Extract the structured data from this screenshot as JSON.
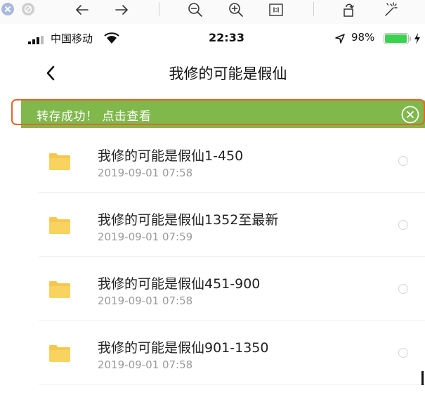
{
  "status_bar": {
    "carrier": "中国移动",
    "time": "22:33",
    "battery": "98%",
    "battery_level": 0.98
  },
  "nav": {
    "title": "我修的可能是假仙"
  },
  "banner": {
    "text": "转存成功！ 点击查看",
    "color": "#80b84c"
  },
  "files": [
    {
      "name": "我修的可能是假仙1-450",
      "date": "2019-09-01 07:58"
    },
    {
      "name": "我修的可能是假仙1352至最新",
      "date": "2019-09-01 07:59"
    },
    {
      "name": "我修的可能是假仙451-900",
      "date": "2019-09-01 07:58"
    },
    {
      "name": "我修的可能是假仙901-1350",
      "date": "2019-09-01 07:58"
    }
  ],
  "colors": {
    "highlight": "#e8632a",
    "folder": "#f5c84d",
    "battery": "#3ad24e"
  },
  "icons": [
    "close-window-icon",
    "minimize-window-icon",
    "back-arrow-icon",
    "forward-arrow-icon",
    "zoom-out-icon",
    "zoom-in-icon",
    "actual-size-icon",
    "rotate-icon",
    "magic-wand-icon",
    "signal-icon",
    "wifi-icon",
    "location-arrow-icon",
    "battery-icon",
    "charging-bolt-icon",
    "back-chevron-icon",
    "close-circle-icon",
    "folder-icon"
  ]
}
